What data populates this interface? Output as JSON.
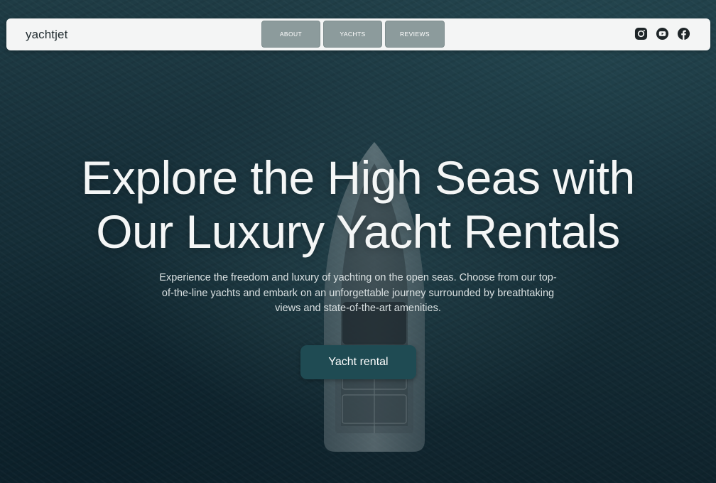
{
  "header": {
    "logo": "yachtjet",
    "nav": [
      {
        "label": "ABOUT"
      },
      {
        "label": "YACHTS"
      },
      {
        "label": "REVIEWS"
      }
    ],
    "socials": [
      "instagram-icon",
      "youtube-icon",
      "facebook-icon"
    ]
  },
  "hero": {
    "title_line1": "Explore the High Seas with",
    "title_line2": "Our Luxury Yacht Rentals",
    "subtitle": "Experience the freedom and luxury of yachting on the open seas. Choose from our top-of-the-line yachts and embark on an unforgettable journey surrounded by breathtaking views and state-of-the-art amenities.",
    "cta_label": "Yacht rental"
  },
  "colors": {
    "background": "#17303a",
    "navbar": "#f4f5f5",
    "nav_button": "#8c9b9c",
    "cta": "#1f4b53"
  }
}
